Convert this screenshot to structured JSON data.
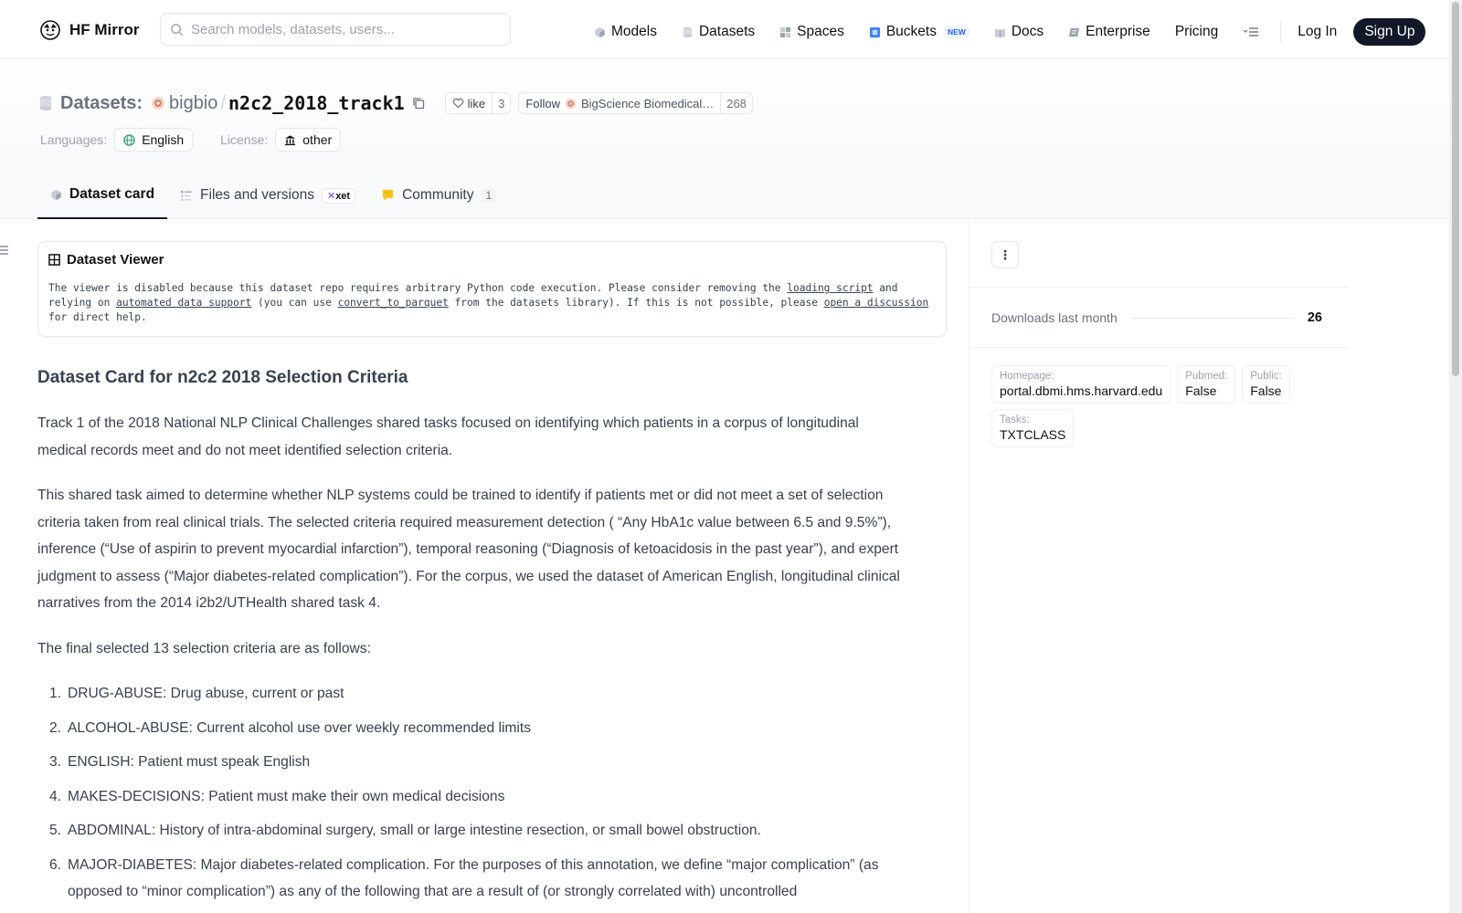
{
  "header": {
    "logo_text": "HF Mirror",
    "search_placeholder": "Search models, datasets, users...",
    "nav": [
      {
        "label": "Models",
        "icon": "models-icon"
      },
      {
        "label": "Datasets",
        "icon": "datasets-icon"
      },
      {
        "label": "Spaces",
        "icon": "spaces-icon"
      },
      {
        "label": "Buckets",
        "icon": "buckets-icon",
        "badge": "NEW"
      },
      {
        "label": "Docs",
        "icon": "docs-icon"
      },
      {
        "label": "Enterprise",
        "icon": "enterprise-icon"
      },
      {
        "label": "Pricing"
      }
    ],
    "login": "Log In",
    "signup": "Sign Up"
  },
  "repo": {
    "type_label": "Datasets:",
    "org": "bigbio",
    "separator": "/",
    "name": "n2c2_2018_track1",
    "like_label": "like",
    "like_count": "3",
    "follow_label": "Follow",
    "follow_org": "BigScience Biomedical…",
    "follow_count": "268",
    "languages_label": "Languages:",
    "language": "English",
    "license_label": "License:",
    "license": "other"
  },
  "tabs": [
    {
      "label": "Dataset card",
      "active": true
    },
    {
      "label": "Files and versions",
      "badge": "xet"
    },
    {
      "label": "Community",
      "count": "1"
    }
  ],
  "viewer": {
    "title": "Dataset Viewer",
    "text_1": "The viewer is disabled because this dataset repo requires arbitrary Python code execution. Please consider removing the ",
    "link_1": "loading script",
    "text_2": " and relying on ",
    "link_2": "automated data support",
    "text_3": " (you can use ",
    "link_3": "convert_to_parquet",
    "text_4": " from the datasets library). If this is not possible, please ",
    "link_4": "open a discussion",
    "text_5": " for direct help."
  },
  "card": {
    "heading": "Dataset Card for n2c2 2018 Selection Criteria",
    "p1": "Track 1 of the 2018 National NLP Clinical Challenges shared tasks focused on identifying which patients in a corpus of longitudinal medical records meet and do not meet identified selection criteria.",
    "p2": "This shared task aimed to determine whether NLP systems could be trained to identify if patients met or did not meet a set of selection criteria taken from real clinical trials. The selected criteria required measurement detection ( “Any HbA1c value between 6.5 and 9.5%”), inference (“Use of aspirin to prevent myocardial infarction”), temporal reasoning (“Diagnosis of ketoacidosis in the past year”), and expert judgment to assess (“Major diabetes-related complication”). For the corpus, we used the dataset of American English, longitudinal clinical narratives from the 2014 i2b2/UTHealth shared task 4.",
    "p3": "The final selected 13 selection criteria are as follows:",
    "items": [
      {
        "num": "1.",
        "text": "DRUG-ABUSE: Drug abuse, current or past"
      },
      {
        "num": "2.",
        "text": "ALCOHOL-ABUSE: Current alcohol use over weekly recommended limits"
      },
      {
        "num": "3.",
        "text": "ENGLISH: Patient must speak English"
      },
      {
        "num": "4.",
        "text": "MAKES-DECISIONS: Patient must make their own medical decisions"
      },
      {
        "num": "5.",
        "text": "ABDOMINAL: History of intra-abdominal surgery, small or large intestine resection, or small bowel obstruction."
      },
      {
        "num": "6.",
        "text": "MAJOR-DIABETES: Major diabetes-related complication. For the purposes of this annotation, we define “major complication” (as opposed to “minor complication”) as any of the following that are a result of (or strongly correlated with) uncontrolled"
      }
    ]
  },
  "sidebar": {
    "downloads_label": "Downloads last month",
    "downloads_value": "26",
    "tags": [
      {
        "key": "Homepage:",
        "value": "portal.dbmi.hms.harvard.edu"
      },
      {
        "key": "Pubmed:",
        "value": "False"
      },
      {
        "key": "Public:",
        "value": "False"
      },
      {
        "key": "Tasks:",
        "value": "TXTCLASS"
      }
    ]
  }
}
